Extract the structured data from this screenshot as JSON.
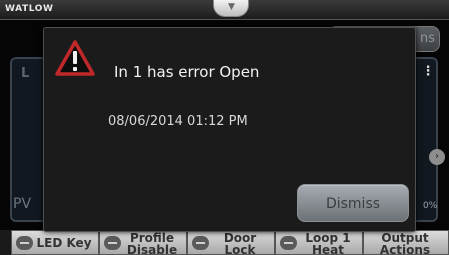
{
  "header": {
    "brand": "WATLOW",
    "top_tab_icon": "chevron-down-icon"
  },
  "background": {
    "top_right_button_label": "ns",
    "panel_letter": "L",
    "pv_label": "PV",
    "percent_text": "0%",
    "menu_icon": "vertical-dots-icon",
    "next_arrow_icon": "chevron-right-icon"
  },
  "dialog": {
    "icon": "warning-triangle-icon",
    "title": "In 1 has error Open",
    "timestamp": "08/06/2014 01:12 PM",
    "dismiss_label": "Dismiss"
  },
  "softkeys": [
    {
      "label": "LED Key",
      "toggle": true
    },
    {
      "label": "Profile\nDisable",
      "toggle": true
    },
    {
      "label": "Door\nLock",
      "toggle": true
    },
    {
      "label": "Loop 1\nHeat",
      "toggle": true
    },
    {
      "label": "Output\nActions",
      "toggle": false
    }
  ],
  "colors": {
    "warning_red": "#c0282a",
    "dialog_bg": "#1b1b1b",
    "dismiss_button": "#8c9196"
  }
}
